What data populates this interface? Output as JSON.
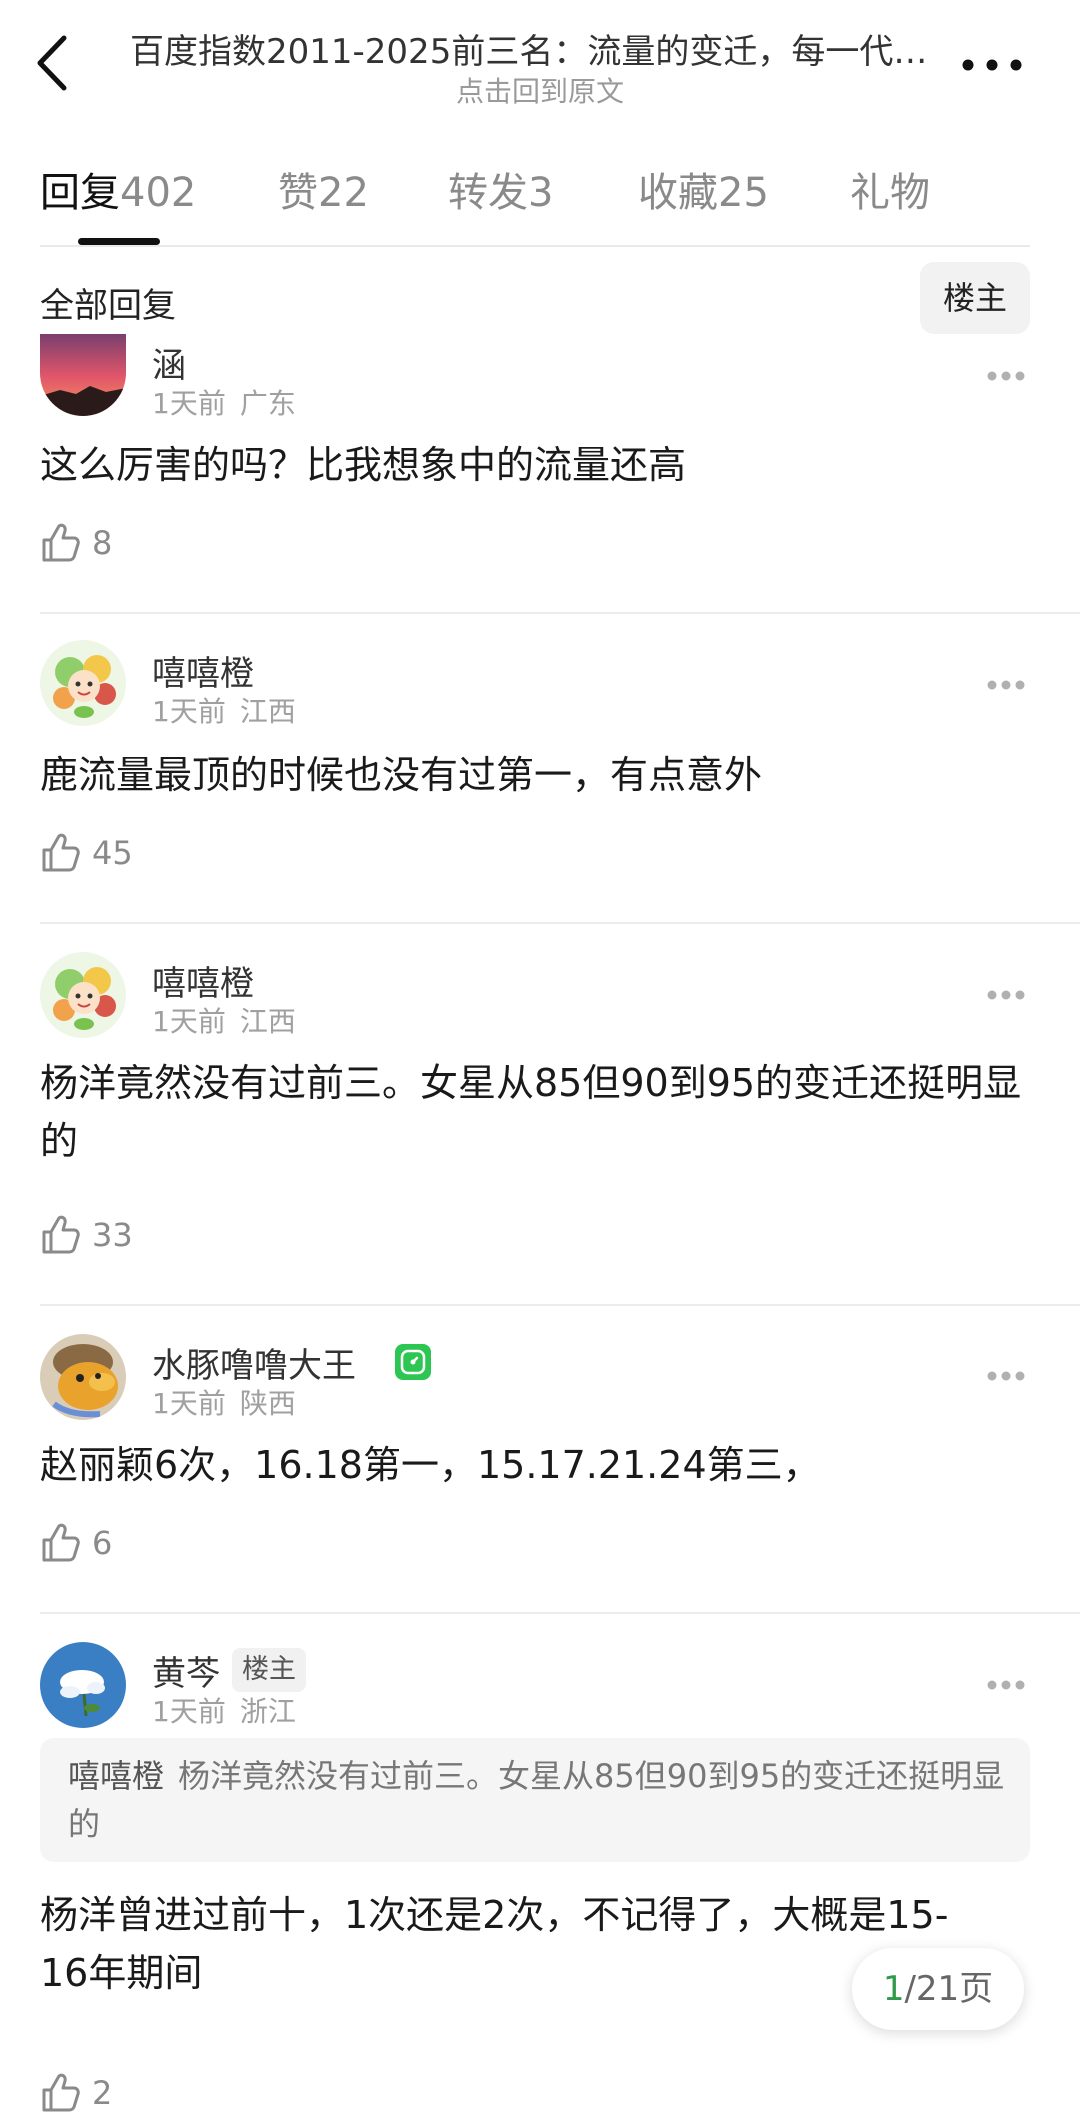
{
  "header": {
    "title": "百度指数2011-2025前三名：流量的变迁，每一代…",
    "subtitle": "点击回到原文"
  },
  "tabs": [
    {
      "label": "回复",
      "count": "402",
      "active": true
    },
    {
      "label": "赞",
      "count": "22"
    },
    {
      "label": "转发",
      "count": "3"
    },
    {
      "label": "收藏",
      "count": "25"
    },
    {
      "label": "礼物",
      "count": ""
    }
  ],
  "filter": {
    "label": "全部回复",
    "op_button": "楼主"
  },
  "comments": [
    {
      "name": "涵",
      "time": "1天前",
      "location": "广东",
      "text": "这么厉害的吗？比我想象中的流量还高",
      "likes": "8"
    },
    {
      "name": "嘻嘻橙",
      "time": "1天前",
      "location": "江西",
      "text": "鹿流量最顶的时候也没有过第一，有点意外",
      "likes": "45"
    },
    {
      "name": "嘻嘻橙",
      "time": "1天前",
      "location": "江西",
      "text": "杨洋竟然没有过前三。女星从85但90到95的变迁还挺明显的",
      "likes": "33"
    },
    {
      "name": "水豚噜噜大王",
      "time": "1天前",
      "location": "陕西",
      "text": "赵丽颖6次，16.18第一，15.17.21.24第三，",
      "likes": "6"
    },
    {
      "name": "黄芩",
      "tag": "楼主",
      "time": "1天前",
      "location": "浙江",
      "quote_author": "嘻嘻橙",
      "quote_text": "杨洋竟然没有过前三。女星从85但90到95的变迁还挺明显的",
      "text": "杨洋曾进过前十，1次还是2次，不记得了，大概是15-16年期间",
      "likes": "2"
    }
  ],
  "pager": {
    "current": "1",
    "total_text": "/21页"
  },
  "colors": {
    "accent_green": "#2e9a4a",
    "badge_green": "#2dc653"
  }
}
